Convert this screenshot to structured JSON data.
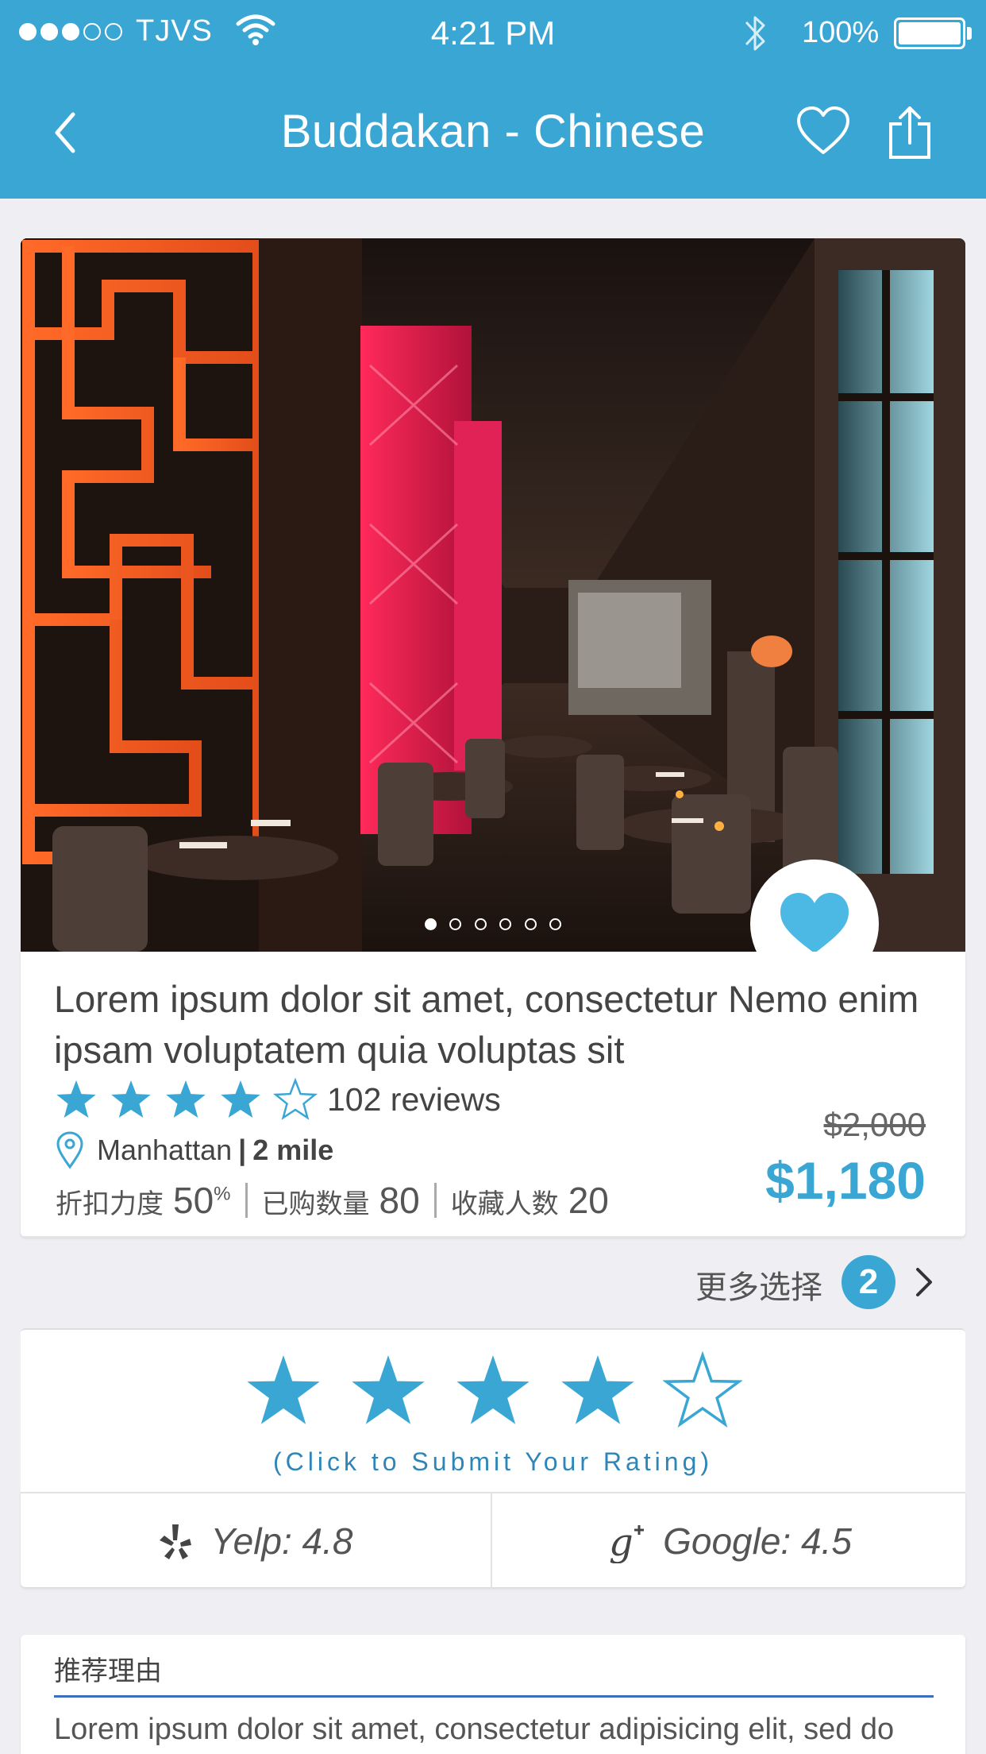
{
  "status_bar": {
    "carrier": "TJVS",
    "time": "4:21 PM",
    "battery": "100%",
    "signal_dots_filled": 3,
    "signal_dots_total": 5
  },
  "nav": {
    "title": "Buddakan - Chinese",
    "back_icon": "chevron-left-icon",
    "favorite_icon": "heart-outline-icon",
    "share_icon": "share-icon"
  },
  "gallery": {
    "page_count": 6,
    "current_page": 1,
    "favorite_icon": "heart-icon"
  },
  "deal": {
    "description": "Lorem ipsum dolor sit amet, consectetur Nemo enim ipsam voluptatem quia voluptas sit",
    "rating_stars": 4,
    "rating_max": 5,
    "reviews": "102 reviews",
    "location": "Manhattan",
    "distance": "2 mile",
    "discount_label": "折扣力度",
    "discount_value": "50",
    "discount_unit": "%",
    "bought_label": "已购数量",
    "bought_value": "80",
    "saved_label": "收藏人数",
    "saved_value": "20",
    "old_price": "$2,000",
    "new_price": "$1,180",
    "more_label": "更多选择",
    "more_count": "2"
  },
  "rating_input": {
    "stars_filled": 4,
    "stars_total": 5,
    "hint": "(Click to Submit Your Rating)"
  },
  "scores": {
    "yelp": "Yelp: 4.8",
    "google": "Google: 4.5"
  },
  "reason": {
    "title": "推荐理由",
    "text": "Lorem ipsum dolor sit amet, consectetur adipisicing elit, sed do"
  },
  "colors": {
    "accent": "#3aa6d4",
    "background": "#efeff3"
  }
}
